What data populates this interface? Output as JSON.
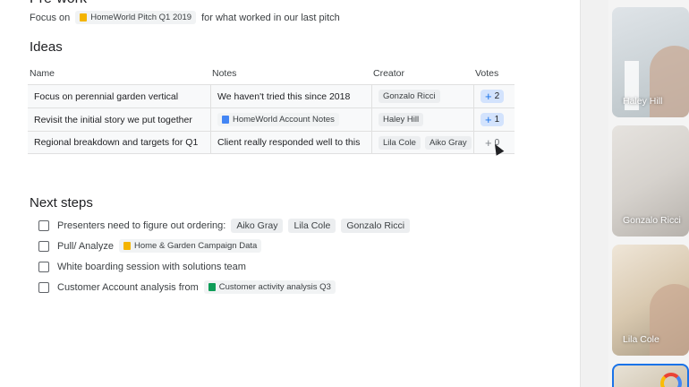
{
  "prework": {
    "title": "Pre-work",
    "focus_prefix": "Focus on",
    "focus_doc": "HomeWorld Pitch Q1 2019",
    "focus_suffix": "for what worked in our last pitch"
  },
  "ideas": {
    "title": "Ideas",
    "headers": [
      "Name",
      "Notes",
      "Creator",
      "Votes"
    ],
    "rows": [
      {
        "name": "Focus on perennial garden vertical",
        "notes": "We haven't tried this since 2018",
        "creators": [
          "Gonzalo Ricci"
        ],
        "votes": "2",
        "voted": true
      },
      {
        "name": "Revisit the initial story we put together",
        "notes_doc": "HomeWorld Account Notes",
        "creators": [
          "Haley Hill"
        ],
        "votes": "1",
        "voted": true
      },
      {
        "name": "Regional breakdown and targets for Q1",
        "notes": "Client really responded well to this",
        "creators": [
          "Lila Cole",
          "Aiko Gray"
        ],
        "votes": "0",
        "voted": false
      }
    ]
  },
  "next_steps": {
    "title": "Next steps",
    "items": [
      {
        "text": "Presenters need to figure out ordering:",
        "people": [
          "Aiko Gray",
          "Lila Cole",
          "Gonzalo Ricci"
        ]
      },
      {
        "text": "Pull/ Analyze",
        "doc": "Home & Garden Campaign Data"
      },
      {
        "text": "White boarding session with solutions team"
      },
      {
        "text": "Customer Account analysis from",
        "sheet": "Customer activity analysis Q3"
      }
    ]
  },
  "participants": [
    "Haley Hill",
    "Gonzalo Ricci",
    "Lila Cole"
  ],
  "colors": {
    "accent": "#1a73e8",
    "vote_bg": "#d3e3fd",
    "doc_icon": "#f4b400",
    "notes_icon": "#4285f4",
    "sheet_icon": "#0f9d58"
  },
  "icons": {
    "doc": "docs-icon",
    "notes": "document-icon",
    "sheet": "sheets-icon",
    "vote": "plus-icon"
  }
}
